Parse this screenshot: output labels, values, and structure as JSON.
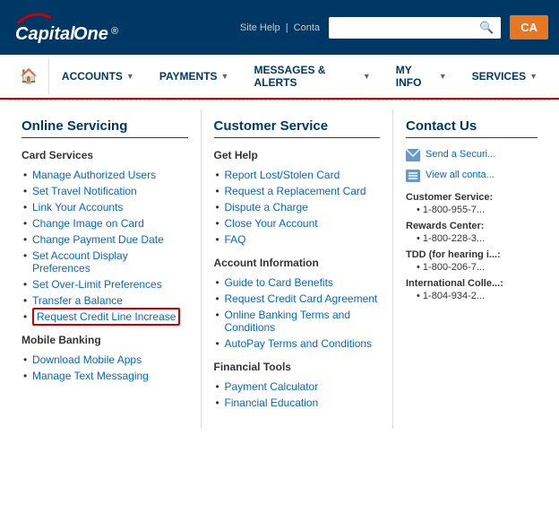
{
  "header": {
    "logo": "Capital One",
    "site_help": "Site Help",
    "separator": "|",
    "contact_label": "Conta",
    "search_placeholder": "",
    "search_icon": "🔍",
    "ca_button": "CA"
  },
  "nav": {
    "home_icon": "🏠",
    "items": [
      {
        "label": "ACCOUNTS",
        "id": "accounts"
      },
      {
        "label": "PAYMENTS",
        "id": "payments"
      },
      {
        "label": "MESSAGES & ALERTS",
        "id": "messages"
      },
      {
        "label": "MY INFO",
        "id": "myinfo"
      },
      {
        "label": "SERVICES",
        "id": "services"
      }
    ]
  },
  "online_servicing": {
    "title": "Online Servicing",
    "card_services_heading": "Card Services",
    "card_services_links": [
      {
        "label": "Manage Authorized Users",
        "highlighted": false
      },
      {
        "label": "Set Travel Notification",
        "highlighted": false
      },
      {
        "label": "Link Your Accounts",
        "highlighted": false
      },
      {
        "label": "Change Image on Card",
        "highlighted": false
      },
      {
        "label": "Change Payment Due Date",
        "highlighted": false
      },
      {
        "label": "Set Account Display Preferences",
        "highlighted": false
      },
      {
        "label": "Set Over-Limit Preferences",
        "highlighted": false
      },
      {
        "label": "Transfer a Balance",
        "highlighted": false
      },
      {
        "label": "Request Credit Line Increase",
        "highlighted": true
      }
    ],
    "mobile_banking_heading": "Mobile Banking",
    "mobile_banking_links": [
      {
        "label": "Download Mobile Apps",
        "highlighted": false
      },
      {
        "label": "Manage Text Messaging",
        "highlighted": false
      }
    ]
  },
  "customer_service": {
    "title": "Customer Service",
    "get_help_heading": "Get Help",
    "get_help_links": [
      {
        "label": "Report Lost/Stolen Card"
      },
      {
        "label": "Request a Replacement Card"
      },
      {
        "label": "Dispute a Charge"
      },
      {
        "label": "Close Your Account"
      },
      {
        "label": "FAQ"
      }
    ],
    "account_info_heading": "Account Information",
    "account_info_links": [
      {
        "label": "Guide to Card Benefits"
      },
      {
        "label": "Request Credit Card Agreement"
      },
      {
        "label": "Online Banking Terms and Conditions"
      },
      {
        "label": "AutoPay Terms and Conditions"
      }
    ],
    "financial_tools_heading": "Financial Tools",
    "financial_tools_links": [
      {
        "label": "Payment Calculator"
      },
      {
        "label": "Financial Education"
      }
    ]
  },
  "contact_us": {
    "title": "Contact Us",
    "icon_links": [
      {
        "icon": "envelope",
        "label": "Send a Securi..."
      },
      {
        "icon": "list",
        "label": "View all conta..."
      }
    ],
    "phone_sections": [
      {
        "label": "Customer Service:",
        "number": "1-800-955-7..."
      },
      {
        "label": "Rewards Center:",
        "number": "1-800-228-3..."
      },
      {
        "label": "TDD (for hearing i...:",
        "number": "1-800-206-7..."
      },
      {
        "label": "International Colle...:",
        "number": "1-804-934-2..."
      }
    ]
  }
}
